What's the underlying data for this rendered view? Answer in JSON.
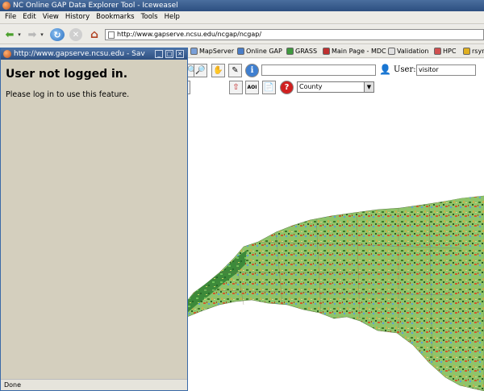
{
  "window": {
    "title": "NC Online GAP Data Explorer Tool - Iceweasel"
  },
  "menu": [
    "File",
    "Edit",
    "View",
    "History",
    "Bookmarks",
    "Tools",
    "Help"
  ],
  "nav": {
    "url": "http://www.gapserve.ncsu.edu/ncgap/ncgap/"
  },
  "bookmarks": [
    {
      "label": "MapServer",
      "color": "#7aa0d8"
    },
    {
      "label": "Online GAP",
      "color": "#4a7ec8"
    },
    {
      "label": "GRASS",
      "color": "#3f9a3f"
    },
    {
      "label": "Main Page - MDC",
      "color": "#c03030"
    },
    {
      "label": "Validation",
      "color": "#e0e0e0"
    },
    {
      "label": "HPC",
      "color": "#d05050"
    },
    {
      "label": "rsyn",
      "color": "#e0b020"
    }
  ],
  "app": {
    "user_label": "User:",
    "user_value": "visitor",
    "aoi_label": "AOI",
    "region_select": "County"
  },
  "popup": {
    "title": "http://www.gapserve.ncsu.edu - Sav",
    "heading": "User not logged in.",
    "message": "Please log in to use this feature.",
    "status": "Done"
  }
}
